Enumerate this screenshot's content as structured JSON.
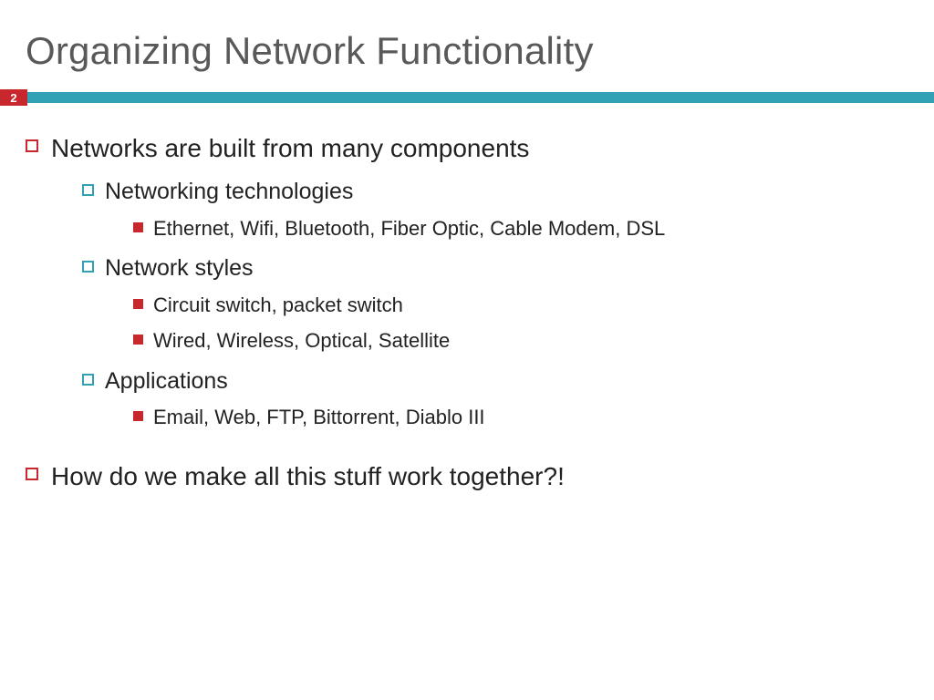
{
  "title": "Organizing Network Functionality",
  "page_number": "2",
  "bullets": {
    "l1_a": "Networks are built from many components",
    "l2_a": "Networking technologies",
    "l3_a": "Ethernet, Wifi, Bluetooth, Fiber Optic, Cable Modem, DSL",
    "l2_b": "Network styles",
    "l3_b": "Circuit switch, packet switch",
    "l3_c": "Wired, Wireless, Optical, Satellite",
    "l2_c": "Applications",
    "l3_d": "Email, Web, FTP, Bittorrent, Diablo III",
    "l1_b": "How do we make all this stuff work together?!"
  }
}
